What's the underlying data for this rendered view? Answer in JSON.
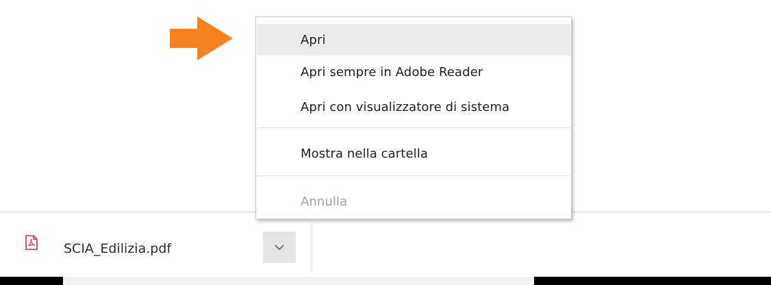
{
  "context_menu": {
    "items": [
      {
        "label": "Apri",
        "state": "highlighted"
      },
      {
        "label": "Apri sempre in Adobe Reader",
        "state": "normal"
      },
      {
        "label": "Apri con visualizzatore di sistema",
        "state": "normal"
      },
      {
        "label": "Mostra nella cartella",
        "state": "normal"
      },
      {
        "label": "Annulla",
        "state": "disabled"
      }
    ]
  },
  "download_shelf": {
    "file_name": "SCIA_Edilizia.pdf",
    "file_icon": "pdf-icon",
    "menu_button_icon": "chevron-down-icon"
  },
  "colors": {
    "arrow": "#f58220",
    "pdf_icon": "#d93025",
    "highlight": "#ebebeb",
    "disabled_text": "#a0a0a0"
  }
}
